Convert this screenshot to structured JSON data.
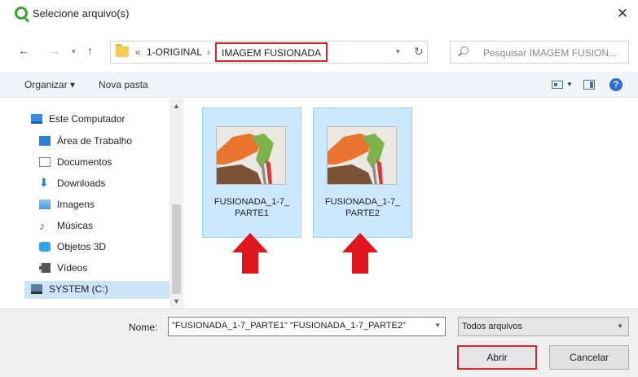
{
  "window": {
    "title": "Selecione arquivo(s)",
    "close_symbol": "✕"
  },
  "address": {
    "path_sep": "«",
    "crumbs": [
      "1-ORIGINAL",
      "IMAGEM FUSIONADA"
    ],
    "crumb_sep": "›",
    "search_placeholder": "Pesquisar IMAGEM FUSION..."
  },
  "toolbar": {
    "organize_label": "Organizar ▾",
    "new_folder_label": "Nova pasta",
    "help_symbol": "?"
  },
  "nav": {
    "items": [
      {
        "label": "Este Computador",
        "icon": "computer-icon",
        "color": "#3a8ee6"
      },
      {
        "label": "Área de Trabalho",
        "icon": "desktop-icon",
        "color": "#2d7fd3"
      },
      {
        "label": "Documentos",
        "icon": "documents-icon",
        "color": "#7a8a9a"
      },
      {
        "label": "Downloads",
        "icon": "downloads-icon",
        "color": "#2b78d0"
      },
      {
        "label": "Imagens",
        "icon": "pictures-icon",
        "color": "#4a9be0"
      },
      {
        "label": "Músicas",
        "icon": "music-icon",
        "color": "#2b78d0"
      },
      {
        "label": "Objetos 3D",
        "icon": "objects3d-icon",
        "color": "#36a0e8"
      },
      {
        "label": "Vídeos",
        "icon": "videos-icon",
        "color": "#555555"
      },
      {
        "label": "SYSTEM (C:)",
        "icon": "drive-icon",
        "color": "#5b7fa6"
      }
    ]
  },
  "files": [
    {
      "name_line1": "FUSIONADA_1-7_",
      "name_line2": "PARTE1"
    },
    {
      "name_line1": "FUSIONADA_1-7_",
      "name_line2": "PARTE2"
    }
  ],
  "footer": {
    "name_label": "Nome:",
    "name_value": "\"FUSIONADA_1-7_PARTE1\" \"FUSIONADA_1-7_PARTE2\"",
    "filetype_value": "Todos arquivos",
    "open_label": "Abrir",
    "cancel_label": "Cancelar"
  },
  "colors": {
    "highlight_red": "#d9252b",
    "selection_blue": "#cce8ff",
    "arrow_red": "#e0161d"
  }
}
